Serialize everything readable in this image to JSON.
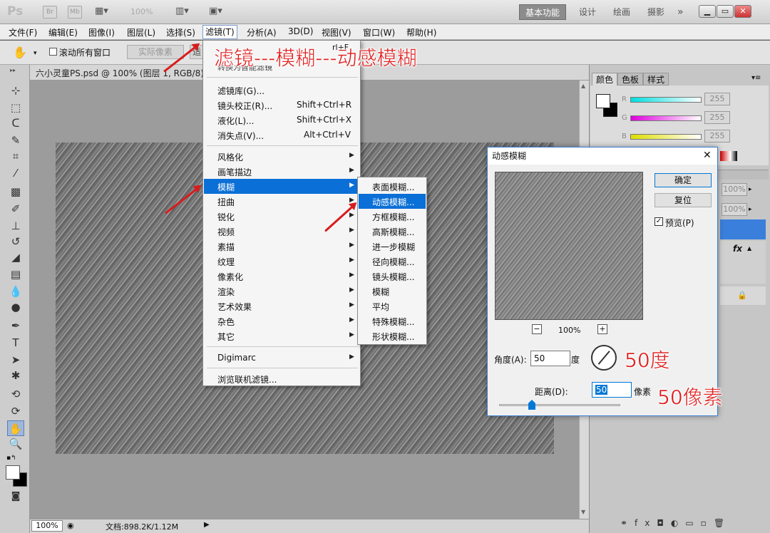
{
  "titlebar": {
    "app_logo": "Ps",
    "btn_br": "Br",
    "btn_mb": "Mb",
    "zoom": "100%",
    "workspaces": [
      "基本功能",
      "设计",
      "绘画",
      "摄影"
    ],
    "more": "»"
  },
  "menubar": {
    "items": [
      "文件(F)",
      "编辑(E)",
      "图像(I)",
      "图层(L)",
      "选择(S)",
      "滤镜(T)",
      "分析(A)",
      "3D(D)",
      "视图(V)",
      "窗口(W)",
      "帮助(H)"
    ],
    "active_index": 5
  },
  "options": {
    "scroll_all": "滚动所有窗口",
    "actual_pixels": "实际像素",
    "fit_partial": "适"
  },
  "document": {
    "tab": "六小灵童PS.psd @ 100% (图层 1, RGB/8) *",
    "zoom": "100%",
    "doc_size": "文档:898.2K/1.12M"
  },
  "filter_menu": {
    "last_filter_shortcut": "rl+F",
    "smart_filter": "转换为智能滤镜",
    "group1": [
      {
        "label": "滤镜库(G)...",
        "shortcut": ""
      },
      {
        "label": "镜头校正(R)...",
        "shortcut": "Shift+Ctrl+R"
      },
      {
        "label": "液化(L)...",
        "shortcut": "Shift+Ctrl+X"
      },
      {
        "label": "消失点(V)...",
        "shortcut": "Alt+Ctrl+V"
      }
    ],
    "group2": [
      "风格化",
      "画笔描边",
      "模糊",
      "扭曲",
      "锐化",
      "视频",
      "素描",
      "纹理",
      "像素化",
      "渲染",
      "艺术效果",
      "杂色",
      "其它"
    ],
    "highlighted": "模糊",
    "digimarc": "Digimarc",
    "browse": "浏览联机滤镜..."
  },
  "blur_submenu": {
    "items": [
      "表面模糊...",
      "动感模糊...",
      "方框模糊...",
      "高斯模糊...",
      "进一步模糊",
      "径向模糊...",
      "镜头模糊...",
      "模糊",
      "平均",
      "特殊模糊...",
      "形状模糊..."
    ],
    "highlighted": "动感模糊..."
  },
  "dialog": {
    "title": "动感模糊",
    "ok": "确定",
    "reset": "复位",
    "preview_label": "预览(P)",
    "preview_checked": true,
    "zoom": "100%",
    "zoom_minus": "−",
    "zoom_plus": "+",
    "angle_label": "角度(A):",
    "angle_value": "50",
    "angle_unit": "度",
    "distance_label": "距离(D):",
    "distance_value": "50",
    "distance_unit": "像素",
    "close": "✕"
  },
  "annotations": {
    "path": "滤镜---模糊---动感模糊",
    "angle": "50度",
    "distance": "50像素"
  },
  "color_panel": {
    "tabs": [
      "颜色",
      "色板",
      "样式"
    ],
    "channels": [
      {
        "label": "R",
        "value": "255",
        "color": "#00e0e0"
      },
      {
        "label": "G",
        "value": "255",
        "color": "#e000e0"
      },
      {
        "label": "B",
        "value": "255",
        "color": "#e0e000"
      }
    ]
  },
  "layers_panel": {
    "opacity": "100%",
    "fill": "100%",
    "fx": "fx"
  }
}
